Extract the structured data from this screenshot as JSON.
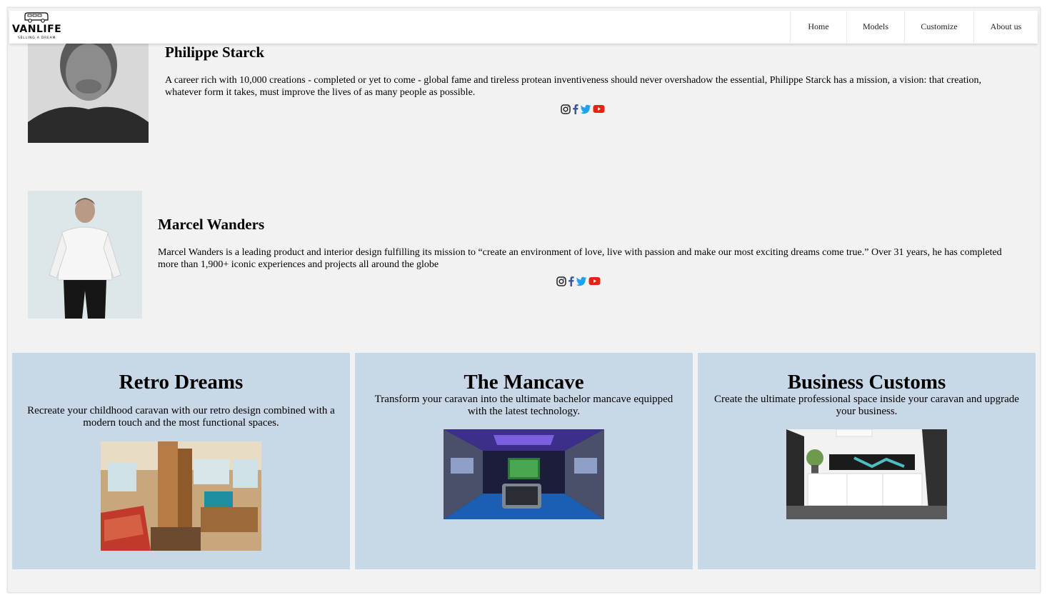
{
  "brand": {
    "name": "VANLIFE",
    "tagline": "SELLING A DREAM"
  },
  "nav": {
    "items": [
      {
        "label": "Home"
      },
      {
        "label": "Models"
      },
      {
        "label": "Customize"
      },
      {
        "label": "About us"
      }
    ]
  },
  "designers": [
    {
      "name": "Philippe Starck",
      "bio": "A career rich with 10,000 creations - completed or yet to come - global fame and tireless protean inventiveness should never overshadow the essential, Philippe Starck has a mission, a vision: that creation, whatever form it takes, must improve the lives of as many people as possible."
    },
    {
      "name": "Marcel Wanders",
      "bio": "Marcel Wanders is a leading product and interior design fulfilling its mission to “create an environment of love, live with passion and make our most exciting dreams come true.” Over 31 years, he has completed more than 1,900+ iconic experiences and projects all around the globe"
    }
  ],
  "social_icons": [
    "instagram-icon",
    "facebook-icon",
    "twitter-icon",
    "youtube-icon"
  ],
  "colors": {
    "card_bg": "#c9d8e6",
    "page_bg": "#f2f2f2",
    "facebook": "#3b5998",
    "twitter": "#1da1f2",
    "youtube": "#e62117"
  },
  "cards": [
    {
      "title": "Retro Dreams",
      "text": "Recreate your childhood caravan with our retro design combined with a modern touch and the most functional spaces."
    },
    {
      "title": "The Mancave",
      "text": "Transform your caravan into the ultimate bachelor mancave equipped with the latest technology."
    },
    {
      "title": "Business Customs",
      "text": "Create the ultimate professional space inside your caravan and upgrade your business."
    }
  ]
}
